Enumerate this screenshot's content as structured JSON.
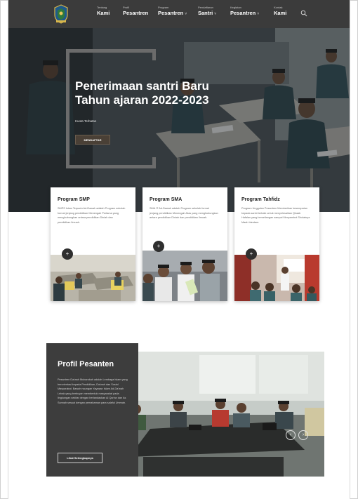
{
  "nav": {
    "items": [
      {
        "small": "Tentang",
        "big": "Kami",
        "caret": false
      },
      {
        "small": "Profil",
        "big": "Pesantren",
        "caret": false
      },
      {
        "small": "Program",
        "big": "Pesantren",
        "caret": true
      },
      {
        "small": "Pendaftaran",
        "big": "Santri",
        "caret": true
      },
      {
        "small": "Kegiatan",
        "big": "Pesantren",
        "caret": true
      },
      {
        "small": "Kontak",
        "big": "Kami",
        "caret": false
      }
    ],
    "caret_glyph": "˅",
    "logo_icon": "pesantren-crest-icon",
    "search_icon": "search-icon"
  },
  "hero": {
    "title": "Penerimaan santri Baru Tahun ajaran 2022-2023",
    "subtitle": "Kuota Terbatas",
    "button": "MENDAFTAR"
  },
  "cards": [
    {
      "title": "Program SMP",
      "text": "SMPS Islam Terpadu Ad-Dawah adalah Program sekolah formal jenjang pendidikan Menengah Pertama yang menghubungkan antara pendidikan Diniah dan pendidikan Ilmuah.",
      "plus": "+"
    },
    {
      "title": "Program SMA",
      "text": "SMA IT Ad-Dawah adalah Program sekolah formal jenjang pendidikan Menengah Atas yang menghubungkan antara pendidikan Diniah dan pendidikan Ilmuah.",
      "plus": "+"
    },
    {
      "title": "Program Tahfidz",
      "text": "Program Unggulan Pesantren Memberikan kesempatan kepada santri terbaik untuk menyelesaikan Qiraah Hafalan yang berseliangan sampai Menyambut Sholatnya Maah Ideutam.",
      "plus": "+"
    }
  ],
  "profil": {
    "title": "Profil Pesanten",
    "text": "Pesantren Da'wah Mubarokah adalah Lembaga Islam yang berorientasi kepada Pendidikan, Da'wah dan Sosial Masyarakat. Bawah naungan Yayasan Islam Ad-Da'wah Lebak yang berbuyan membentuk masyarakat pada lingkungan sekitar dengan berlandaskan Al Qur'an dan As Sunnah sesuai dengan pemahaman para salaful Ummah.",
    "button": "Lihat Selengkapnya",
    "prev": "‹",
    "next": "›"
  },
  "colors": {
    "nav_bg": "#3b3b3b",
    "profil_bg": "#3d3d3d",
    "hero_button": "#4a4036"
  }
}
